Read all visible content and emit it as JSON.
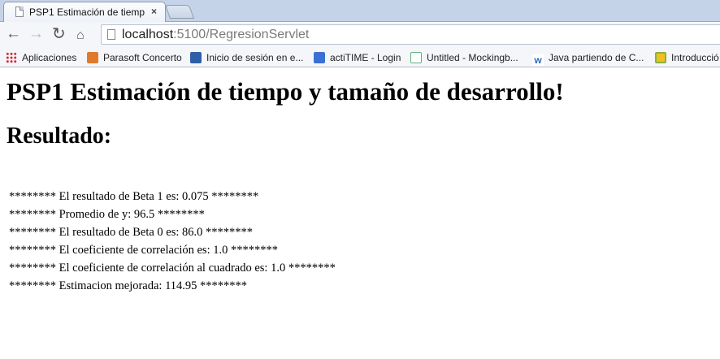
{
  "browser": {
    "tab_title": "PSP1 Estimación de tiemp",
    "tab_close": "×",
    "url_host": "localhost",
    "url_rest": ":5100/RegresionServlet"
  },
  "bookmarks": [
    {
      "label": "Aplicaciones",
      "icon": "apps-grid-icon"
    },
    {
      "label": "Parasoft Concerto",
      "icon": "parasoft-icon"
    },
    {
      "label": "Inicio de sesión en e...",
      "icon": "chart-icon"
    },
    {
      "label": "actiTIME - Login",
      "icon": "actitime-icon"
    },
    {
      "label": "Untitled - Mockingb...",
      "icon": "mockingbird-icon"
    },
    {
      "label": "Java partiendo de C...",
      "icon": "w-icon"
    },
    {
      "label": "Introducció",
      "icon": "moodle-icon"
    }
  ],
  "page": {
    "heading": "PSP1 Estimación de tiempo y tamaño de desarrollo!",
    "subheading": "Resultado:",
    "results": [
      "******** El resultado de Beta 1 es: 0.075 ********",
      "******** Promedio de y: 96.5 ********",
      "******** El resultado de Beta 0 es: 86.0 ********",
      "******** El coeficiente de correlación es: 1.0 ********",
      "******** El coeficiente de correlación al cuadrado es: 1.0 ********",
      "******** Estimacion mejorada: 114.95 ********"
    ]
  }
}
